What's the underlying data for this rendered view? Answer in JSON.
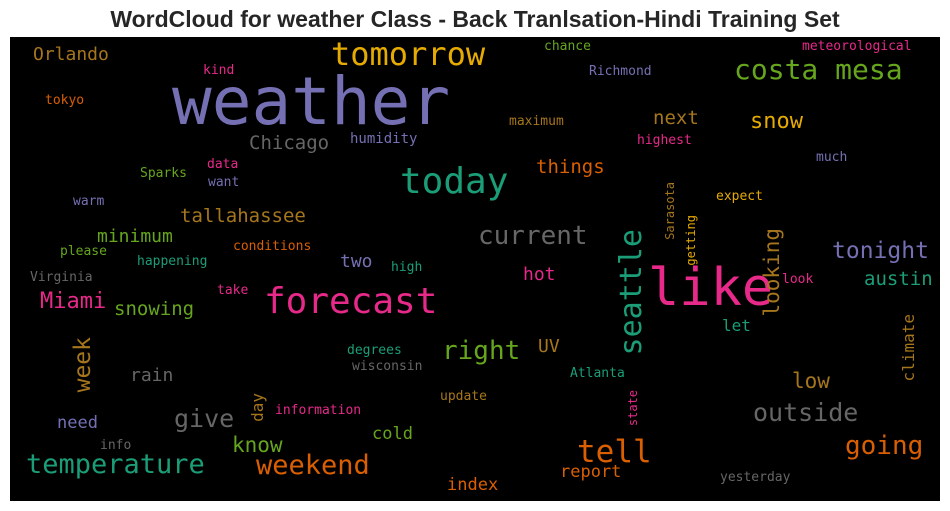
{
  "title": "WordCloud for weather Class - Back Tranlsation-Hindi Training Set",
  "colors": {
    "background": "#000000",
    "purple": "#7570b3",
    "green": "#1b9e77",
    "orange": "#d95f02",
    "pink": "#e7298a",
    "lime": "#66a61e",
    "gold": "#e6ab02",
    "brown": "#a6761d",
    "gray": "#666666"
  },
  "words": {
    "weather": "weather",
    "tomorrow": "tomorrow",
    "costa_mesa": "costa mesa",
    "like": "like",
    "today": "today",
    "forecast": "forecast",
    "seattle": "seattle",
    "temperature": "temperature",
    "weekend": "weekend",
    "tell": "tell",
    "current": "current",
    "right": "right",
    "going": "going",
    "outside": "outside",
    "snow": "snow",
    "tonight": "tonight",
    "give": "give",
    "miami": "Miami",
    "week": "week",
    "looking": "looking",
    "know": "know",
    "next": "next",
    "chicago": "Chicago",
    "orlando": "Orlando",
    "austin": "austin",
    "low": "low",
    "things": "things",
    "tallahassee": "tallahassee",
    "minimum": "minimum",
    "snowing": "snowing",
    "two": "two",
    "hot": "hot",
    "rain": "rain",
    "uv": "UV",
    "cold": "cold",
    "index": "index",
    "report": "report",
    "climate": "climate",
    "need": "need",
    "let": "let",
    "day": "day",
    "humidity": "humidity",
    "maximum": "maximum",
    "highest": "highest",
    "chance": "chance",
    "meteorological": "meteorological",
    "richmond": "Richmond",
    "kind": "kind",
    "tokyo": "tokyo",
    "much": "much",
    "data": "data",
    "want": "want",
    "sparks": "Sparks",
    "warm": "warm",
    "expect": "expect",
    "sarasota": "Sarasota",
    "getting": "getting",
    "conditions": "conditions",
    "please": "please",
    "happening": "happening",
    "high": "high",
    "virginia": "Virginia",
    "take": "take",
    "look": "look",
    "degrees": "degrees",
    "wisconsin": "wisconsin",
    "atlanta": "Atlanta",
    "update": "update",
    "information": "information",
    "state": "state",
    "info": "info",
    "yesterday": "yesterday"
  }
}
